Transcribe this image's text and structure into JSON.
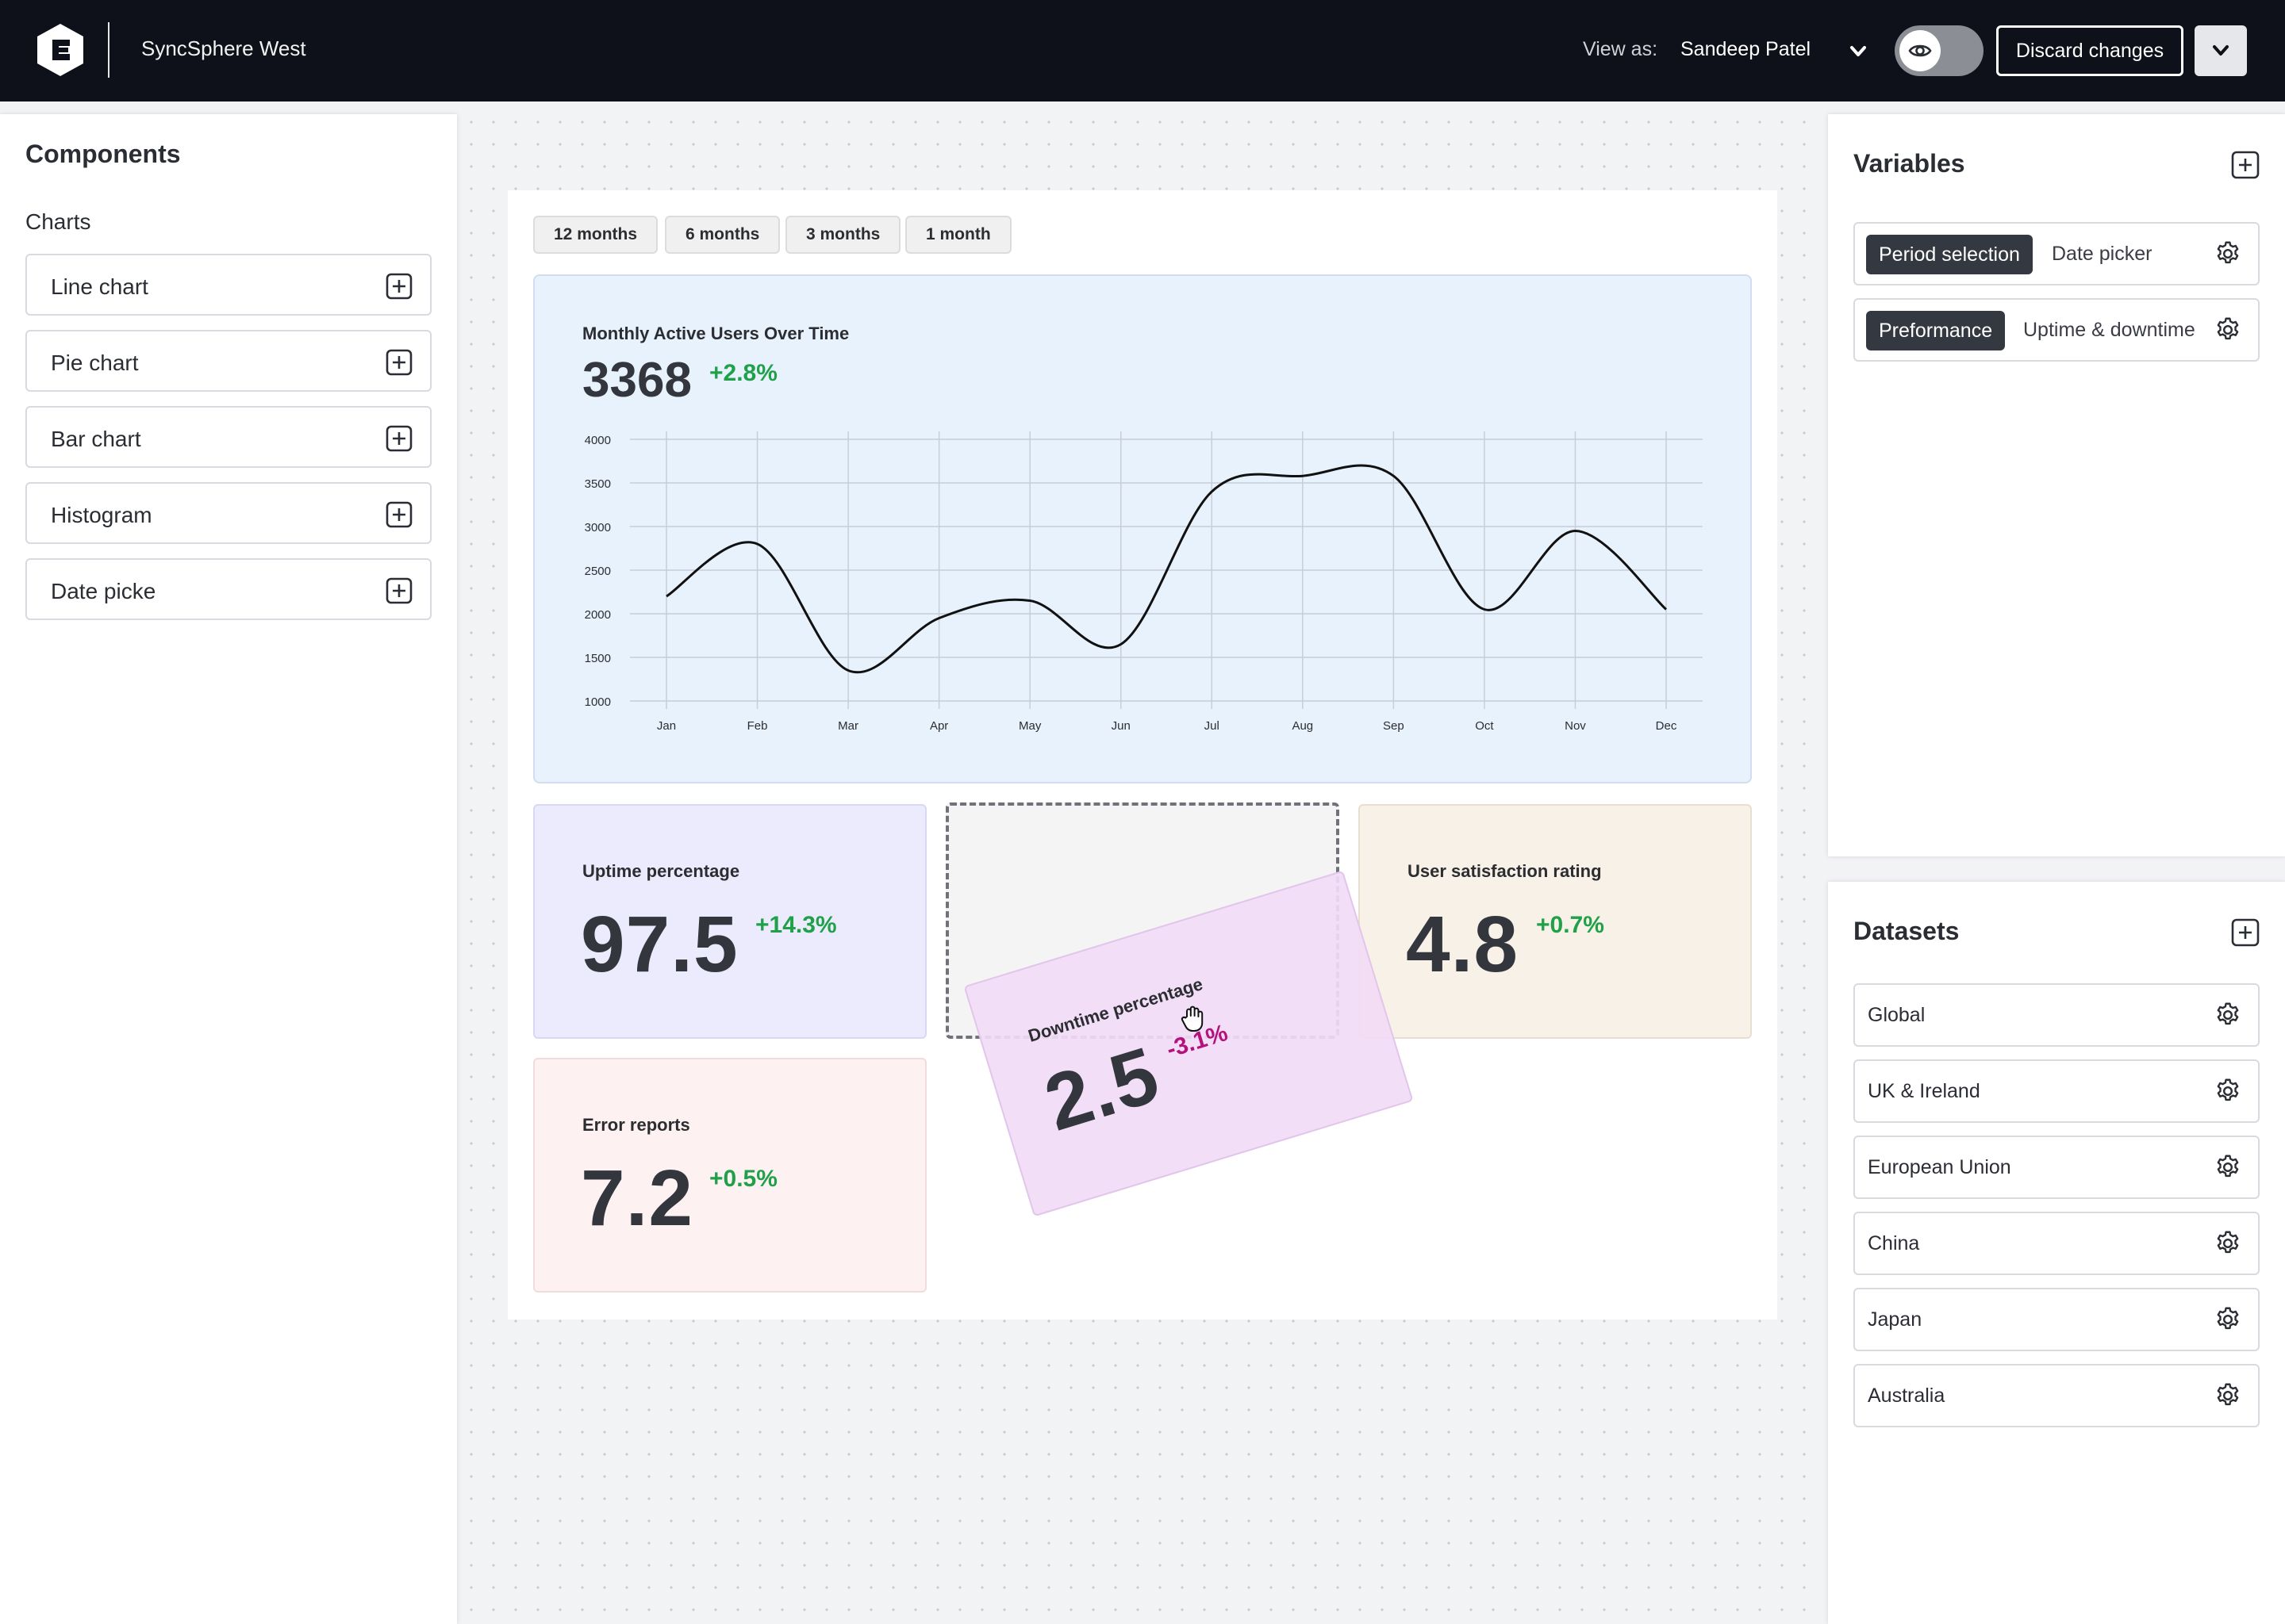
{
  "app": {
    "workspace_name": "SyncSphere West",
    "view_as_label": "View as:",
    "view_as_user": "Sandeep Patel",
    "discard_label": "Discard changes"
  },
  "components_panel": {
    "title": "Components",
    "section": "Charts",
    "items": [
      {
        "label": "Line chart"
      },
      {
        "label": "Pie chart"
      },
      {
        "label": "Bar chart"
      },
      {
        "label": "Histogram"
      },
      {
        "label": "Date picke"
      }
    ]
  },
  "variables_panel": {
    "title": "Variables",
    "items": [
      {
        "name": "Period selection",
        "type": "Date picker"
      },
      {
        "name": "Preformance",
        "type": "Uptime & downtime"
      }
    ]
  },
  "datasets_panel": {
    "title": "Datasets",
    "items": [
      {
        "label": "Global"
      },
      {
        "label": "UK & Ireland"
      },
      {
        "label": "European Union"
      },
      {
        "label": "China"
      },
      {
        "label": "Japan"
      },
      {
        "label": "Australia"
      }
    ]
  },
  "periods": [
    "12 months",
    "6 months",
    "3 months",
    "1 month"
  ],
  "chart_data": {
    "type": "line",
    "title": "Monthly Active Users Over Time",
    "value": "3368",
    "delta": "+2.8%",
    "categories": [
      "Jan",
      "Feb",
      "Mar",
      "Apr",
      "May",
      "Jun",
      "Jul",
      "Aug",
      "Sep",
      "Oct",
      "Nov",
      "Dec"
    ],
    "series": [
      {
        "values": [
          2200,
          2800,
          1350,
          1950,
          2150,
          1650,
          3400,
          3580,
          3580,
          2050,
          2950,
          2050
        ]
      }
    ],
    "y_ticks": [
      4000,
      3500,
      3000,
      2500,
      2000,
      1500,
      1000
    ],
    "ylim": [
      1000,
      4000
    ],
    "grid": true,
    "line_color": "#111111"
  },
  "stats": {
    "uptime": {
      "title": "Uptime percentage",
      "value": "97.5",
      "delta": "+14.3%"
    },
    "satisfaction": {
      "title": "User satisfaction rating",
      "value": "4.8",
      "delta": "+0.7%"
    },
    "errors": {
      "title": "Error reports",
      "value": "7.2",
      "delta": "+0.5%"
    },
    "downtime": {
      "title": "Downtime percentage",
      "value": "2.5",
      "delta": "-3.1%"
    }
  },
  "colors": {
    "topbar": "#0e1119",
    "chart_bg": "#e8f2fd",
    "uptime_bg": "#ebebfd",
    "satisfaction_bg": "#f7f1e7",
    "errors_bg": "#fef1f1",
    "downtime_bg": "#f1dbf6",
    "positive": "#1fa049",
    "negative": "#b3127c"
  }
}
